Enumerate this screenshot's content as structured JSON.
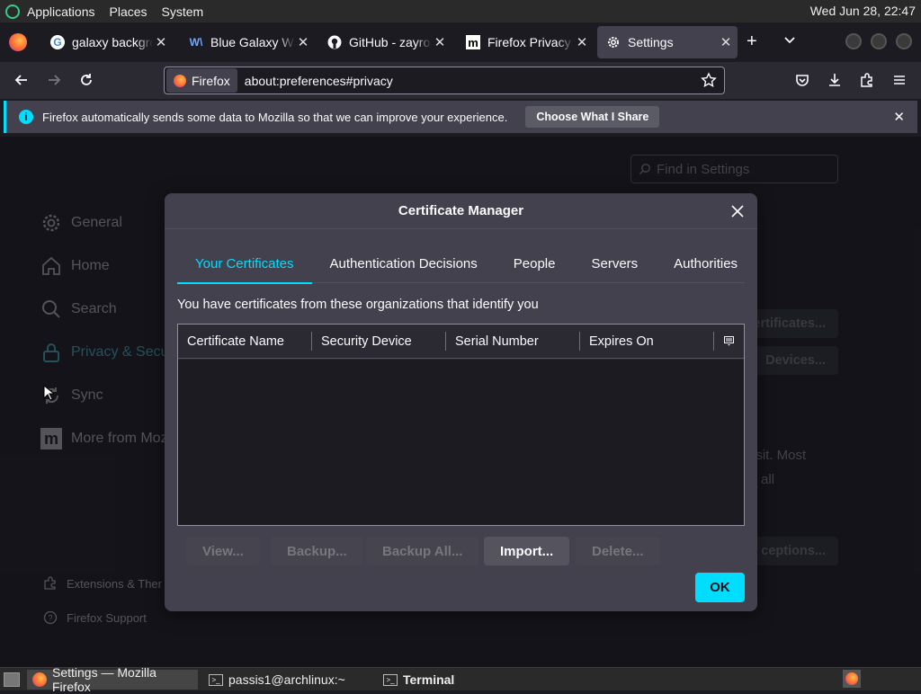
{
  "system_bar": {
    "menu": [
      "Applications",
      "Places",
      "System"
    ],
    "clock": "Wed Jun 28, 22:47"
  },
  "tabs": [
    {
      "title": "galaxy backgrou",
      "icon": "google-icon"
    },
    {
      "title": "Blue Galaxy Wall",
      "icon": "wallpaper-site-icon"
    },
    {
      "title": "GitHub - zayron",
      "icon": "github-icon"
    },
    {
      "title": "Firefox Privacy N",
      "icon": "mozilla-icon"
    },
    {
      "title": "Settings",
      "icon": "gear-icon",
      "active": true
    }
  ],
  "urlbar": {
    "identity": "Firefox",
    "url": "about:preferences#privacy"
  },
  "notification": {
    "message": "Firefox automatically sends some data to Mozilla so that we can improve your experience.",
    "button": "Choose What I Share"
  },
  "settings": {
    "search_placeholder": "Find in Settings",
    "sidebar": [
      {
        "label": "General",
        "icon": "gear-icon"
      },
      {
        "label": "Home",
        "icon": "home-icon"
      },
      {
        "label": "Search",
        "icon": "search-icon"
      },
      {
        "label": "Privacy & Secu",
        "icon": "lock-icon",
        "selected": true
      },
      {
        "label": "Sync",
        "icon": "sync-icon"
      },
      {
        "label": "More from Moz",
        "icon": "mozilla-icon"
      }
    ],
    "sidebar_footer": [
      {
        "label": "Extensions & Ther",
        "icon": "puzzle-icon"
      },
      {
        "label": "Firefox Support",
        "icon": "help-icon"
      }
    ],
    "background": {
      "view_certificates": "ertificates...",
      "security_devices": "Devices...",
      "text_line1": "isit. Most",
      "text_line2": "all",
      "exceptions": "ceptions..."
    }
  },
  "dialog": {
    "title": "Certificate Manager",
    "tabs": [
      "Your Certificates",
      "Authentication Decisions",
      "People",
      "Servers",
      "Authorities"
    ],
    "selected_tab": "Your Certificates",
    "intro": "You have certificates from these organizations that identify you",
    "columns": [
      "Certificate Name",
      "Security Device",
      "Serial Number",
      "Expires On"
    ],
    "rows": [],
    "buttons": {
      "view": "View...",
      "backup": "Backup...",
      "backup_all": "Backup All...",
      "import": "Import...",
      "delete": "Delete..."
    },
    "ok": "OK"
  },
  "taskbar": {
    "items": [
      "Settings — Mozilla Firefox",
      "passis1@archlinux:~",
      "Terminal"
    ]
  },
  "colors": {
    "accent": "#00ddff",
    "background": "#1c1b22",
    "dialog": "#42414d",
    "toolbar": "#2b2a33"
  }
}
